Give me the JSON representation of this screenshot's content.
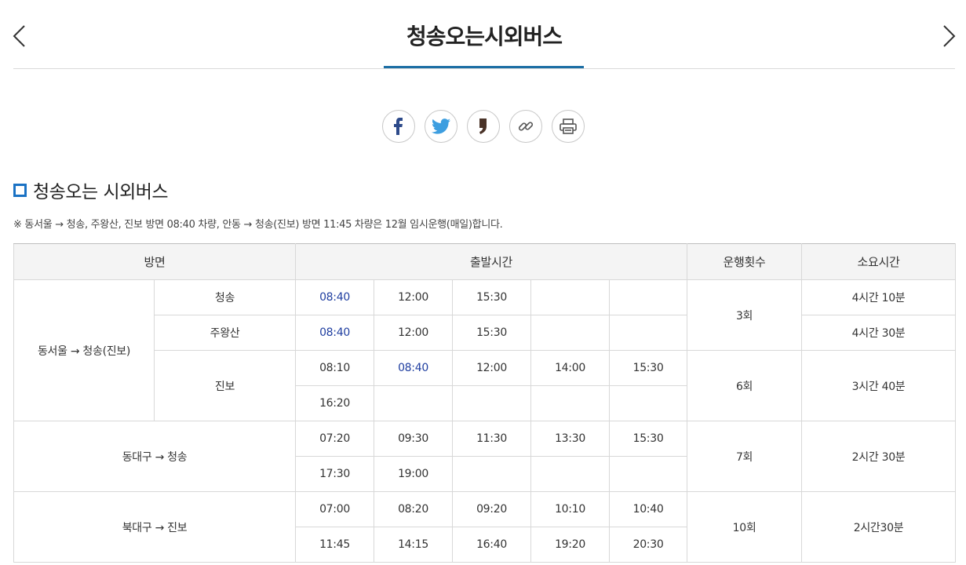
{
  "header": {
    "title": "청송오는시외버스",
    "colors": {
      "accent": "#1c6ea4",
      "highlight_time": "#1f3ea0"
    }
  },
  "share": {
    "icons": [
      "facebook-icon",
      "twitter-icon",
      "kakaostory-icon",
      "link-icon",
      "print-icon"
    ]
  },
  "section": {
    "title": "청송오는 시외버스",
    "notice": "※ 동서울 → 청송, 주왕산, 진보 방면 08:40 차량, 안동 → 청송(진보) 방면 11:45 차량은 12월 임시운행(매일)합니다."
  },
  "table": {
    "headers": {
      "direction": "방면",
      "departure": "출발시간",
      "count": "운행횟수",
      "duration": "소요시간"
    },
    "groups": [
      {
        "route": "동서울 → 청송(진보)",
        "subs": [
          {
            "name": "청송",
            "times": [
              "08:40",
              "12:00",
              "15:30",
              "",
              ""
            ],
            "duration": "4시간 10분"
          },
          {
            "name": "주왕산",
            "times": [
              "08:40",
              "12:00",
              "15:30",
              "",
              ""
            ],
            "duration": "4시간 30분"
          },
          {
            "name": "진보",
            "times": [
              "08:10",
              "08:40",
              "12:00",
              "14:00",
              "15:30",
              "16:20",
              "",
              "",
              "",
              ""
            ],
            "duration": "3시간 40분"
          }
        ],
        "count_a": "3회",
        "count_b": "6회"
      },
      {
        "route": "동대구 → 청송",
        "times": [
          "07:20",
          "09:30",
          "11:30",
          "13:30",
          "15:30",
          "17:30",
          "19:00",
          "",
          "",
          ""
        ],
        "count": "7회",
        "duration": "2시간 30분"
      },
      {
        "route": "북대구 → 진보",
        "times": [
          "07:00",
          "08:20",
          "09:20",
          "10:10",
          "10:40",
          "11:45",
          "14:15",
          "16:40",
          "19:20",
          "20:30"
        ],
        "count": "10회",
        "duration": "2시간30분"
      }
    ]
  }
}
